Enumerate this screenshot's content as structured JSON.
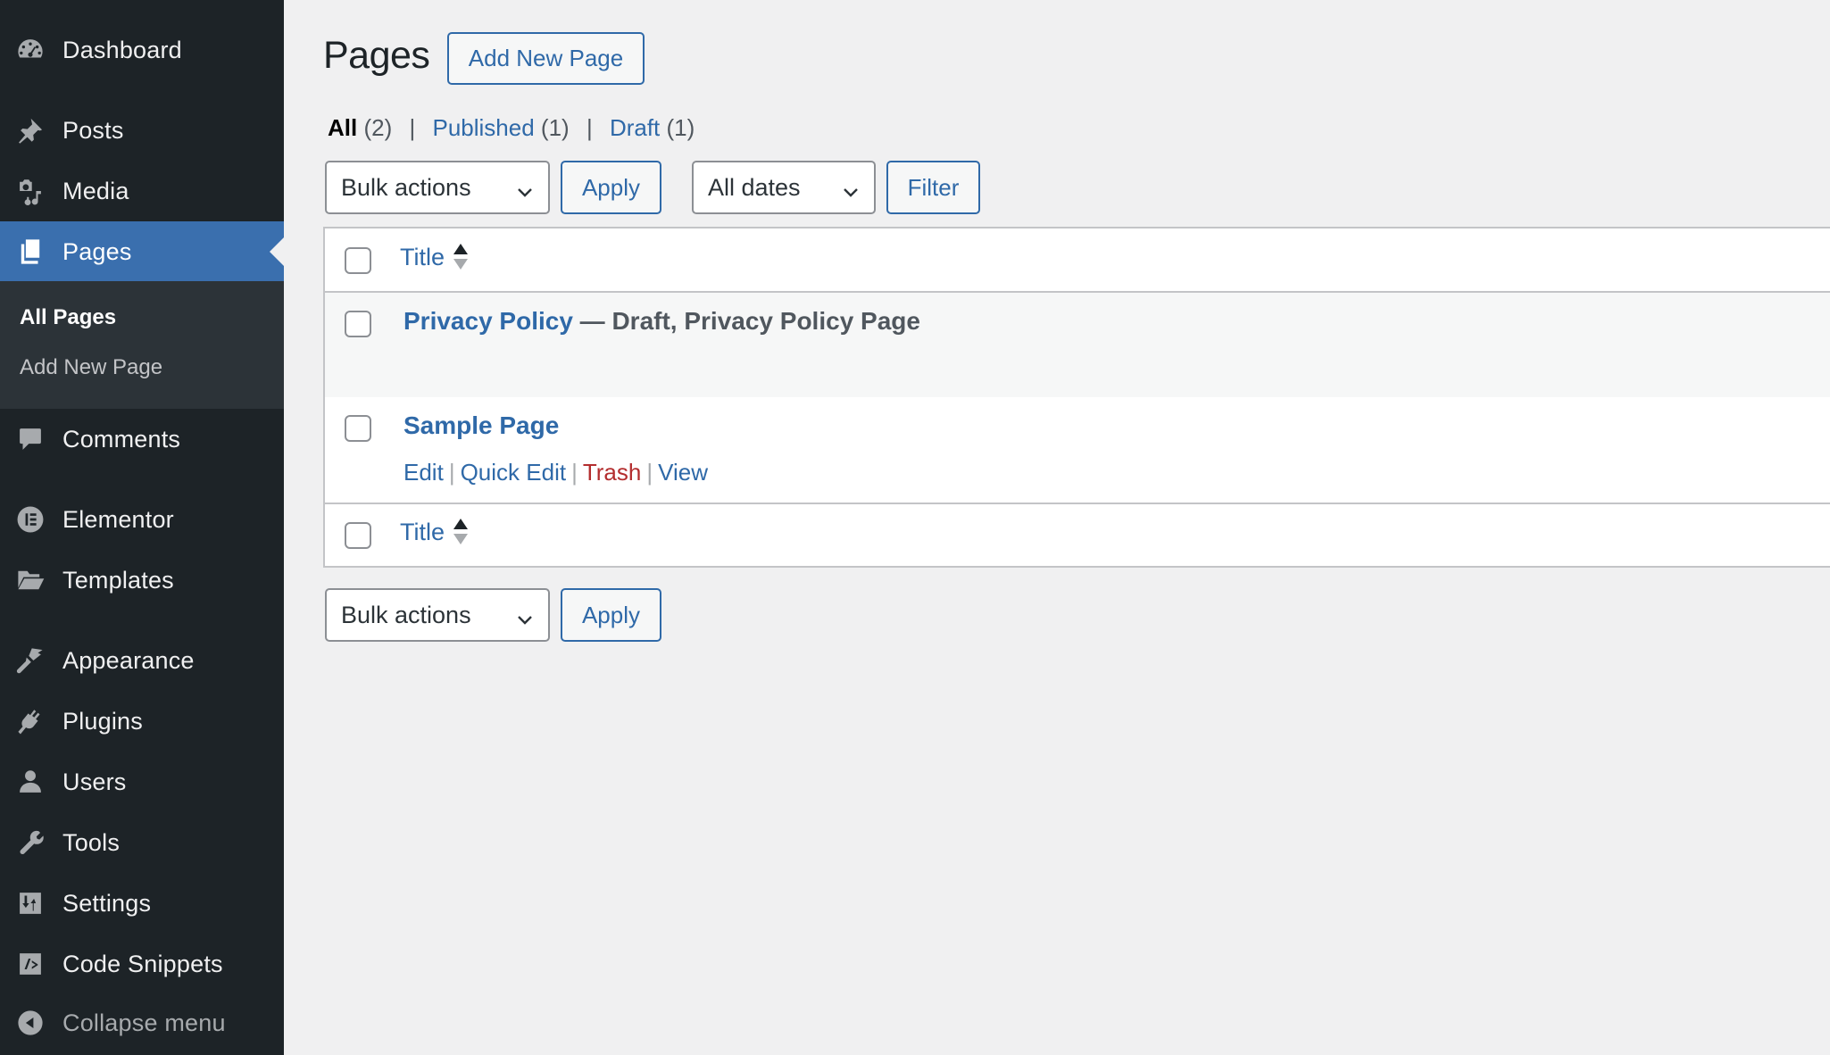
{
  "sidebar": {
    "items": [
      {
        "label": "Dashboard",
        "icon": "dashboard-icon"
      },
      {
        "label": "Posts",
        "icon": "pushpin-icon"
      },
      {
        "label": "Media",
        "icon": "media-icon"
      },
      {
        "label": "Pages",
        "icon": "pages-icon",
        "current": true
      },
      {
        "label": "Comments",
        "icon": "comment-icon"
      },
      {
        "label": "Elementor",
        "icon": "elementor-icon"
      },
      {
        "label": "Templates",
        "icon": "folder-icon"
      },
      {
        "label": "Appearance",
        "icon": "paintbrush-icon"
      },
      {
        "label": "Plugins",
        "icon": "plug-icon"
      },
      {
        "label": "Users",
        "icon": "user-icon"
      },
      {
        "label": "Tools",
        "icon": "wrench-icon"
      },
      {
        "label": "Settings",
        "icon": "settings-sliders-icon"
      },
      {
        "label": "Code Snippets",
        "icon": "code-icon"
      }
    ],
    "submenu": [
      {
        "label": "All Pages",
        "current": true
      },
      {
        "label": "Add New Page"
      }
    ],
    "collapse_label": "Collapse menu"
  },
  "header": {
    "title": "Pages",
    "add_new_label": "Add New Page"
  },
  "filters": {
    "views": [
      {
        "label": "All",
        "count": "(2)",
        "current": true
      },
      {
        "label": "Published",
        "count": "(1)"
      },
      {
        "label": "Draft",
        "count": "(1)"
      }
    ],
    "separator": "|"
  },
  "tablenav_top": {
    "bulk_actions": "Bulk actions",
    "apply_label": "Apply",
    "dates": "All dates",
    "filter_label": "Filter"
  },
  "table": {
    "column_title": "Title",
    "rows": [
      {
        "title": "Privacy Policy",
        "state": " — Draft, Privacy Policy Page",
        "actions": []
      },
      {
        "title": "Sample Page",
        "state": "",
        "actions": [
          "Edit",
          "Quick Edit",
          "Trash",
          "View"
        ]
      }
    ]
  },
  "tablenav_bottom": {
    "bulk_actions": "Bulk actions",
    "apply_label": "Apply"
  },
  "colors": {
    "sidebar_bg": "#1d2327",
    "accent": "#2f69a8",
    "current_menu_bg": "#3a6fae",
    "trash": "#b32d2e"
  }
}
